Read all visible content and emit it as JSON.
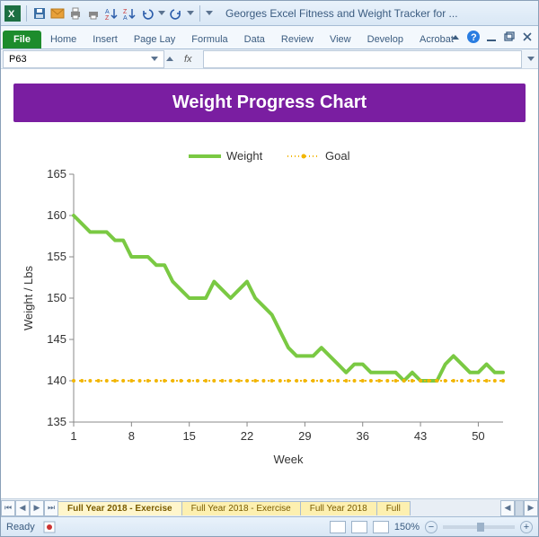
{
  "window": {
    "title": "Georges Excel Fitness and Weight Tracker for ..."
  },
  "ribbon": {
    "file": "File",
    "tabs": [
      "Home",
      "Insert",
      "Page Lay",
      "Formula",
      "Data",
      "Review",
      "View",
      "Develop",
      "Acrobat"
    ]
  },
  "formula": {
    "nameBox": "P63",
    "fxLabel": "fx",
    "value": ""
  },
  "chartHeader": "Weight Progress Chart",
  "chart_data": {
    "type": "line",
    "title": "Weight Progress Chart",
    "xlabel": "Week",
    "ylabel": "Weight / Lbs",
    "ylim": [
      135,
      165
    ],
    "xlim": [
      1,
      53
    ],
    "x_ticks": [
      1,
      8,
      15,
      22,
      29,
      36,
      43,
      50
    ],
    "y_ticks": [
      135,
      140,
      145,
      150,
      155,
      160,
      165
    ],
    "series": [
      {
        "name": "Weight",
        "color": "#7ac943",
        "style": "line-thick",
        "x": [
          1,
          2,
          3,
          4,
          5,
          6,
          7,
          8,
          9,
          10,
          11,
          12,
          13,
          14,
          15,
          16,
          17,
          18,
          19,
          20,
          21,
          22,
          23,
          24,
          25,
          26,
          27,
          28,
          29,
          30,
          31,
          32,
          33,
          34,
          35,
          36,
          37,
          38,
          39,
          40,
          41,
          42,
          43,
          44,
          45,
          46,
          47,
          48,
          49,
          50,
          51,
          52,
          53
        ],
        "y": [
          160,
          159,
          158,
          158,
          158,
          157,
          157,
          155,
          155,
          155,
          154,
          154,
          152,
          151,
          150,
          150,
          150,
          152,
          151,
          150,
          151,
          152,
          150,
          149,
          148,
          146,
          144,
          143,
          143,
          143,
          144,
          143,
          142,
          141,
          142,
          142,
          141,
          141,
          141,
          141,
          140,
          141,
          140,
          140,
          140,
          142,
          143,
          142,
          141,
          141,
          142,
          141,
          141
        ]
      },
      {
        "name": "Goal",
        "color": "#f2b600",
        "style": "dashed-dots",
        "x": [
          1,
          53
        ],
        "y": [
          140,
          140
        ]
      }
    ]
  },
  "sheetTabs": {
    "active": "Full Year 2018 - Exercise",
    "others": [
      "Full Year 2018 - Exercise",
      "Full Year 2018",
      "Full"
    ]
  },
  "status": {
    "ready": "Ready",
    "zoom": "150%"
  }
}
